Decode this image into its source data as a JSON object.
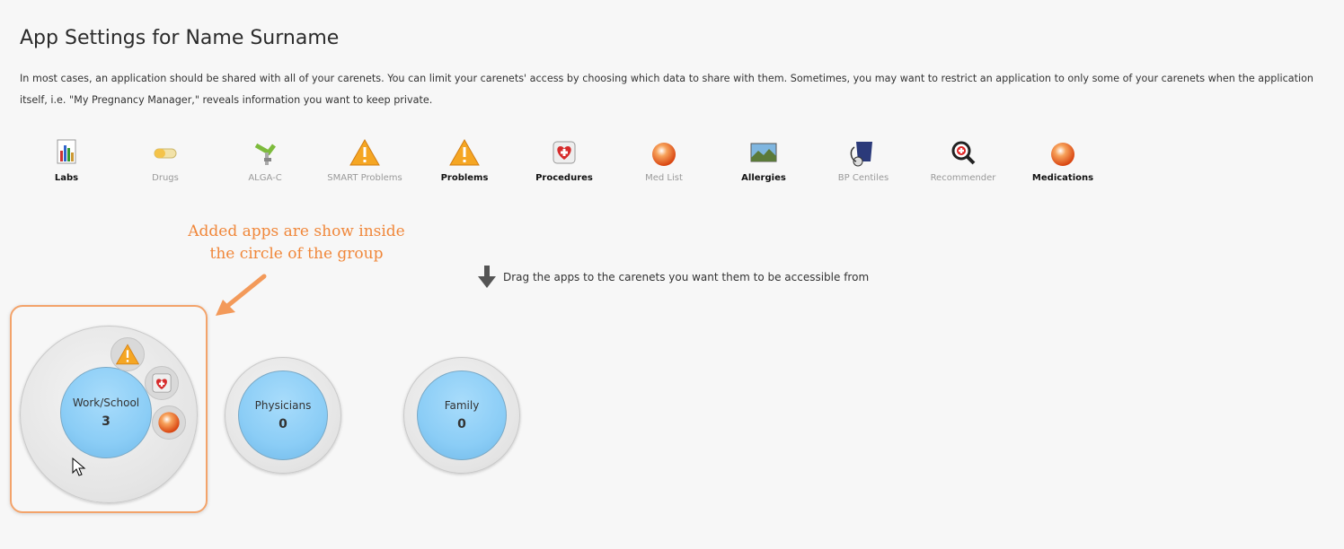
{
  "page": {
    "title": "App Settings for Name Surname",
    "description": "In most cases, an application should be shared with all of your carenets. You can limit your carenets' access by choosing which data to share with them. Sometimes, you may want to restrict an application to only some of your carenets when the application itself, i.e. \"My Pregnancy Manager,\" reveals information you want to keep private."
  },
  "apps": [
    {
      "label": "Labs",
      "icon": "bar-chart-icon",
      "active": true
    },
    {
      "label": "Drugs",
      "icon": "pill-icon",
      "active": false
    },
    {
      "label": "ALGA-C",
      "icon": "alga-c-icon",
      "active": false
    },
    {
      "label": "SMART Problems",
      "icon": "warning-icon",
      "active": false
    },
    {
      "label": "Problems",
      "icon": "warning-icon",
      "active": true
    },
    {
      "label": "Procedures",
      "icon": "heart-plus-icon",
      "active": true
    },
    {
      "label": "Med List",
      "icon": "orange-sphere-icon",
      "active": false
    },
    {
      "label": "Allergies",
      "icon": "landscape-photo-icon",
      "active": true
    },
    {
      "label": "BP Centiles",
      "icon": "blood-pressure-cuff-icon",
      "active": false
    },
    {
      "label": "Recommender",
      "icon": "magnifier-icon",
      "active": false
    },
    {
      "label": "Medications",
      "icon": "orange-sphere-icon",
      "active": true
    }
  ],
  "annotation": {
    "line1": "Added apps are show inside",
    "line2": "the circle of the group"
  },
  "hint": "Drag the apps to the carenets you want them to be accessible from",
  "groups": [
    {
      "name": "Work/School",
      "count": "3",
      "apps": [
        "warning-icon",
        "heart-plus-icon",
        "orange-sphere-icon"
      ]
    },
    {
      "name": "Physicians",
      "count": "0"
    },
    {
      "name": "Family",
      "count": "0"
    }
  ],
  "colors": {
    "accent": "#f0873a",
    "group_inner": "#8bcdf6",
    "background": "#f7f7f7"
  }
}
